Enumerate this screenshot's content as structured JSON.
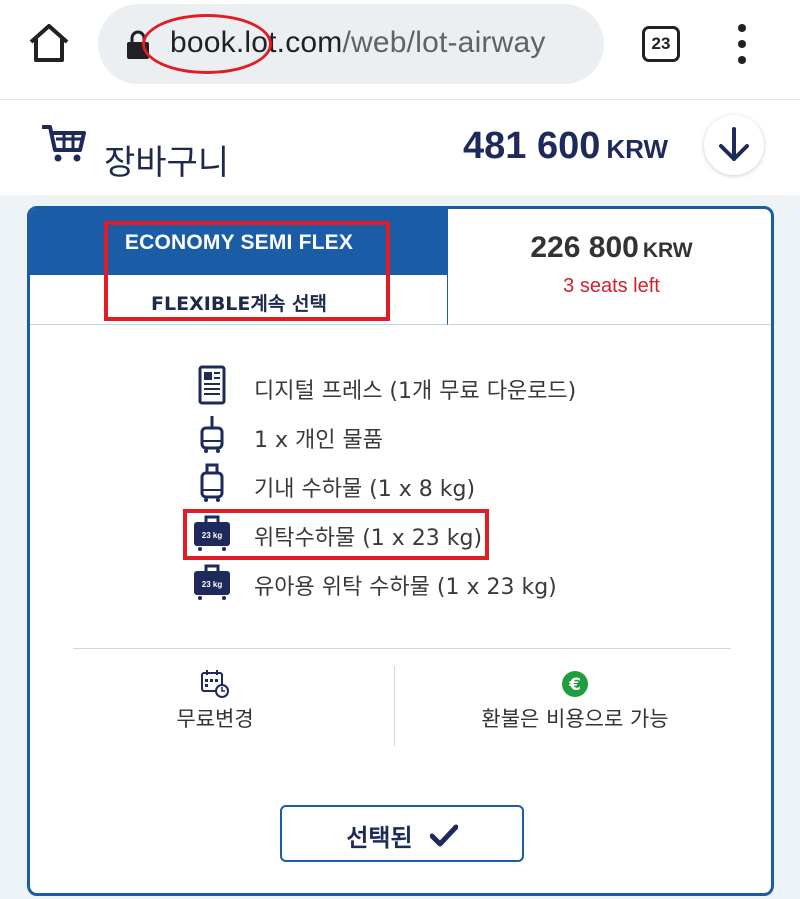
{
  "browser": {
    "url_host_prefix": "book",
    "url_host_main": ".lot.com",
    "url_path": "/web/lot-airway",
    "tab_count": "23"
  },
  "cart": {
    "label": "장바구니",
    "total_amount": "481 600",
    "total_currency": "KRW"
  },
  "fare": {
    "name": "ECONOMY SEMI FLEX",
    "subtitle": "FLEXIBLE계속 선택",
    "price_amount": "226 800",
    "price_currency": "KRW",
    "seats_left": "3 seats left",
    "benefits": [
      {
        "icon": "digital-press-icon",
        "label": "디지털 프레스 (1개 무료 다운로드)"
      },
      {
        "icon": "personal-item-icon",
        "label": "1 x 개인 물품"
      },
      {
        "icon": "cabin-bag-icon",
        "label": "기내 수하물  (1 x 8 kg)"
      },
      {
        "icon": "checked-bag-icon",
        "label": "위탁수하물 (1 x 23 kg)",
        "icon_text": "23 kg"
      },
      {
        "icon": "infant-checked-bag-icon",
        "label": "유아용 위탁 수하물 (1 x 23 kg)"
      }
    ],
    "features": {
      "change": "무료변경",
      "refund": "환불은 비용으로 가능"
    },
    "select_button": "선택된"
  },
  "colors": {
    "brand_blue": "#1a5da6",
    "navy": "#1e2a5c",
    "alert_red": "#d0202e",
    "annotation_red": "#e31b23",
    "refund_green": "#1e9e3e"
  }
}
